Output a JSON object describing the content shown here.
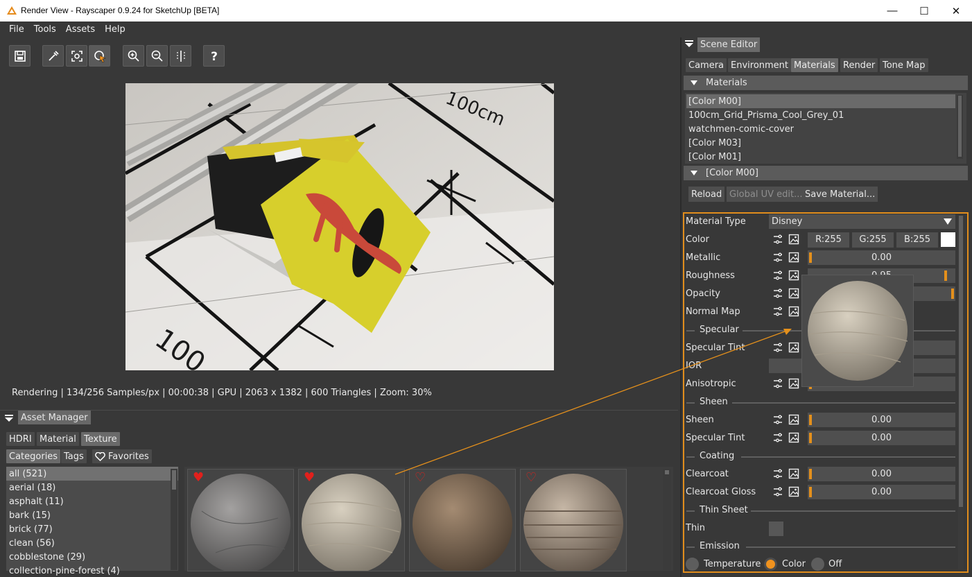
{
  "window": {
    "title": "Render View - Rayscaper 0.9.24 for SketchUp [BETA]",
    "minimize": "—",
    "maximize": "☐",
    "close": "✕"
  },
  "menu": [
    "File",
    "Tools",
    "Assets",
    "Help"
  ],
  "toolbar": [
    "save-icon",
    "eyedropper-icon",
    "focus-icon",
    "select-pointer-icon",
    "zoom-in-icon",
    "zoom-out-icon",
    "compare-icon",
    "help-icon"
  ],
  "status": "Rendering | 134/256 Samples/px | 00:00:38 | GPU | 2063 x 1382 | 600 Triangles | Zoom: 30%",
  "render_labels": {
    "top": "100cm",
    "bottom": "100"
  },
  "asset_manager": {
    "title": "Asset Manager",
    "tabs": [
      "HDRI",
      "Material",
      "Texture"
    ],
    "subtabs": [
      "Categories",
      "Tags",
      "Favorites"
    ],
    "categories": [
      "all (521)",
      "aerial (18)",
      "asphalt (11)",
      "bark (15)",
      "brick (77)",
      "clean (56)",
      "cobblestone (29)",
      "collection-pine-forest (4)"
    ],
    "thumbs": [
      {
        "name": "gray-stone-sphere",
        "favorite": true
      },
      {
        "name": "sand-ripple-sphere",
        "favorite": true
      },
      {
        "name": "brown-dirt-sphere",
        "favorite": false
      },
      {
        "name": "striped-rock-sphere",
        "favorite": false
      }
    ]
  },
  "scene_editor": {
    "title": "Scene Editor",
    "tabs": [
      "Camera",
      "Environment",
      "Materials",
      "Render",
      "Tone Map"
    ],
    "materials_header": "Materials",
    "materials": [
      "[Color M00]",
      "100cm_Grid_Prisma_Cool_Grey_01",
      "watchmen-comic-cover",
      "[Color M03]",
      "[Color M01]"
    ],
    "selected_header": "[Color M00]",
    "buttons": {
      "reload": "Reload",
      "global_uv": "Global UV edit...",
      "save_material": "Save Material..."
    },
    "props": {
      "material_type_label": "Material Type",
      "material_type_value": "Disney",
      "color_label": "Color",
      "color_r": "R:255",
      "color_g": "G:255",
      "color_b": "B:255",
      "metallic_label": "Metallic",
      "metallic_value": "0.00",
      "roughness_label": "Roughness",
      "roughness_value": "0.95",
      "opacity_label": "Opacity",
      "normal_map_label": "Normal Map",
      "specular_section": "Specular",
      "specular_tint_label": "Specular Tint",
      "ior_label": "IOR",
      "anisotropic_label": "Anisotropic",
      "anisotropic_value": "0.00",
      "sheen_section": "Sheen",
      "sheen_label": "Sheen",
      "sheen_value": "0.00",
      "sheen_tint_label": "Specular Tint",
      "sheen_tint_value": "0.00",
      "coating_section": "Coating",
      "clearcoat_label": "Clearcoat",
      "clearcoat_value": "0.00",
      "clearcoat_gloss_label": "Clearcoat Gloss",
      "clearcoat_gloss_value": "0.00",
      "thin_sheet_section": "Thin Sheet",
      "thin_label": "Thin",
      "emission_section": "Emission",
      "emission_options": [
        "Temperature",
        "Color",
        "Off"
      ]
    }
  },
  "colors": {
    "accent": "#e4901c",
    "panel": "#383838",
    "selected": "#6a6a6a"
  }
}
